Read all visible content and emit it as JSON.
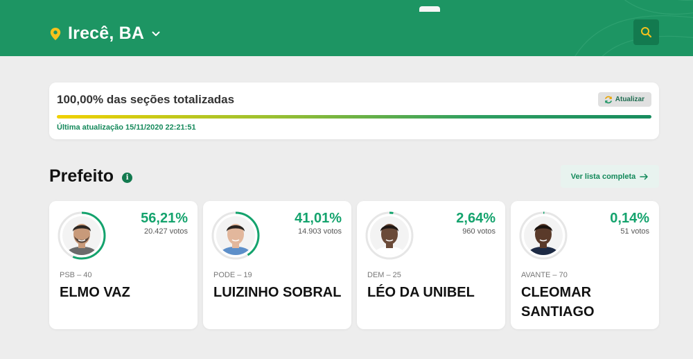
{
  "header": {
    "location": "Irecê, BA"
  },
  "status": {
    "title": "100,00% das seções totalizadas",
    "progress": 1.0,
    "refresh_label": "Atualizar",
    "last_update": "Última atualização 15/11/2020 22:21:51"
  },
  "section": {
    "title": "Prefeito",
    "see_all_label": "Ver lista completa"
  },
  "candidates": [
    {
      "pct_text": "56,21%",
      "pct": 56.21,
      "votes": "20.427 votos",
      "party": "PSB – 40",
      "name": "ELMO VAZ"
    },
    {
      "pct_text": "41,01%",
      "pct": 41.01,
      "votes": "14.903 votos",
      "party": "PODE – 19",
      "name": "LUIZINHO SOBRAL"
    },
    {
      "pct_text": "2,64%",
      "pct": 2.64,
      "votes": "960 votos",
      "party": "DEM – 25",
      "name": "LÉO DA UNIBEL"
    },
    {
      "pct_text": "0,14%",
      "pct": 0.14,
      "votes": "51 votos",
      "party": "AVANTE – 70",
      "name": "CLEOMAR SANTIAGO"
    }
  ],
  "colors": {
    "brand_green": "#1d9563",
    "accent_green": "#14a36d",
    "pin_yellow": "#f6c21d"
  }
}
